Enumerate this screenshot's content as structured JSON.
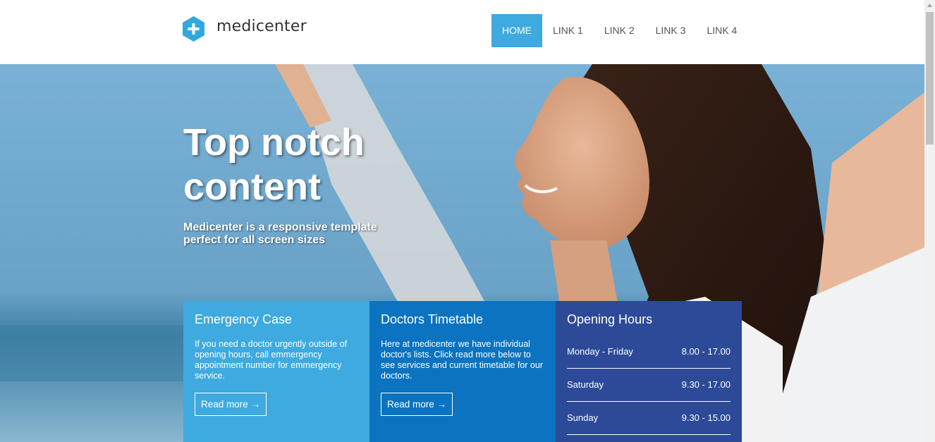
{
  "header": {
    "logo_text": "medicenter",
    "nav": [
      {
        "label": "HOME",
        "active": true
      },
      {
        "label": "LINK 1",
        "active": false
      },
      {
        "label": "LINK 2",
        "active": false
      },
      {
        "label": "LINK 3",
        "active": false
      },
      {
        "label": "LINK 4",
        "active": false
      }
    ]
  },
  "hero": {
    "title": "Top notch content",
    "subtitle": "Medicenter is a responsive template perfect for all screen sizes"
  },
  "boxes": {
    "emergency": {
      "title": "Emergency Case",
      "text": "If you need a doctor urgently outside of opening hours, call emmergency appointment number for emmergency service.",
      "button": "Read more →"
    },
    "timetable": {
      "title": "Doctors Timetable",
      "text": "Here at medicenter we have individual doctor's lists. Click read more below to see services and current timetable for our doctors.",
      "button": "Read more →"
    },
    "hours": {
      "title": "Opening Hours",
      "rows": [
        {
          "day": "Monday - Friday",
          "time": "8.00 - 17.00"
        },
        {
          "day": "Saturday",
          "time": "9.30 - 17.00"
        },
        {
          "day": "Sunday",
          "time": "9.30 - 15.00"
        }
      ]
    }
  },
  "colors": {
    "accent": "#3eaadf",
    "box_blue": "#0b73bf",
    "box_navy": "#2c4a97"
  },
  "icons": {
    "logo": "plus-hexagon-icon"
  }
}
